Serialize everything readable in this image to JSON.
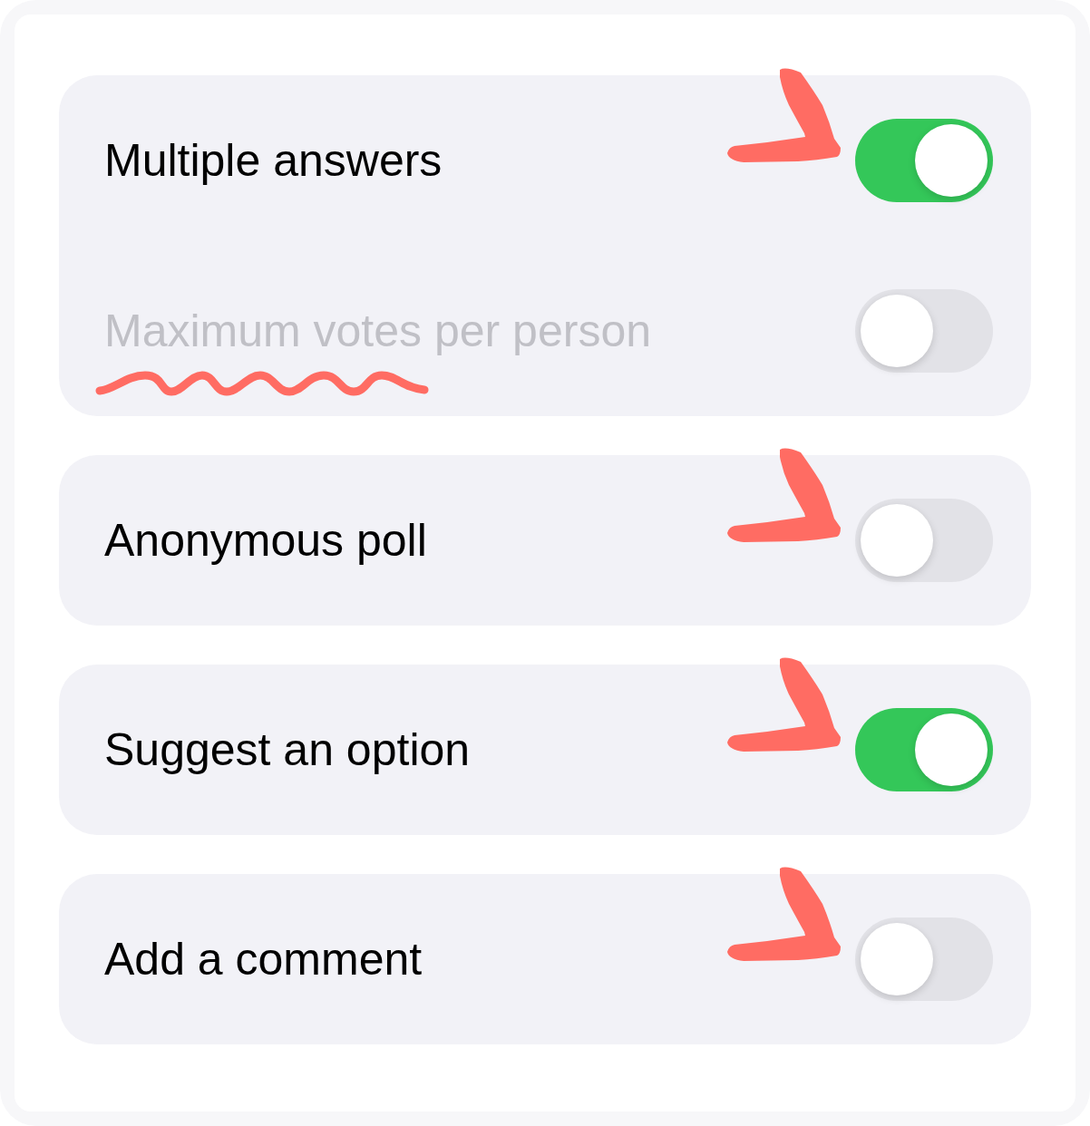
{
  "sections": [
    {
      "rows": [
        {
          "label": "Multiple answers",
          "on": true,
          "disabled": false,
          "arrow": true,
          "underlined": false
        },
        {
          "label": "Maximum votes per person",
          "on": false,
          "disabled": true,
          "arrow": false,
          "underlined": true
        }
      ]
    },
    {
      "rows": [
        {
          "label": "Anonymous poll",
          "on": false,
          "disabled": false,
          "arrow": true,
          "underlined": false
        }
      ]
    },
    {
      "rows": [
        {
          "label": "Suggest an option",
          "on": true,
          "disabled": false,
          "arrow": true,
          "underlined": false
        }
      ]
    },
    {
      "rows": [
        {
          "label": "Add a comment",
          "on": false,
          "disabled": false,
          "arrow": true,
          "underlined": false
        }
      ]
    }
  ]
}
